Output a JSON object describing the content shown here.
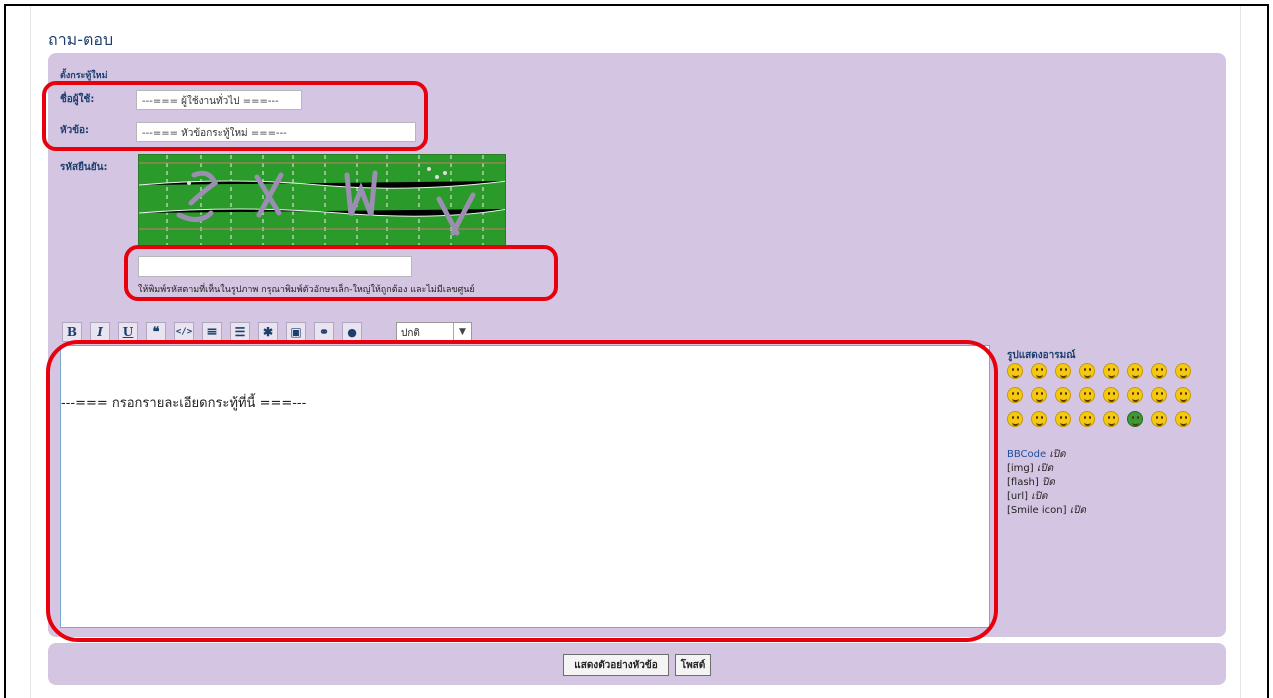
{
  "page": {
    "title": "ถาม-ตอบ"
  },
  "form": {
    "section_title": "ตั้งกระทู้ใหม่",
    "username_label": "ชื่อผู้ใช้:",
    "username_value": "---=== ผู้ใช้งานทั่วไป ===---",
    "subject_label": "หัวข้อ:",
    "subject_value": "---=== หัวข้อกระทู้ใหม่ ===---",
    "captcha_label": "รหัสยืนยัน:",
    "captcha_input_value": "",
    "captcha_hint": "ให้พิมพ์รหัสตามที่เห็นในรูปภาพ กรุณาพิมพ์ตัวอักษรเล็ก-ใหญ่ให้ถูกต้อง และไม่มีเลขศูนย์"
  },
  "toolbar": {
    "bold": "B",
    "italic": "I",
    "underline": "U",
    "quote": "❝",
    "code": "</>",
    "list": "≡",
    "ordered_list": "☰",
    "list_item": "✱",
    "image": "▣",
    "link": "⚭",
    "color": "●",
    "size_select": "ปกติ"
  },
  "editor": {
    "content": "---=== กรอกรายละเอียดกระทู้ที่นี้ ===---"
  },
  "emoticons": {
    "title": "รูปแสดงอารมณ์",
    "count": 24
  },
  "bbcode_status": {
    "bbcode_label": "BBCode",
    "bbcode_state": "เปิด",
    "img_label": "[img]",
    "img_state": "เปิด",
    "flash_label": "[flash]",
    "flash_state": "ปิด",
    "url_label": "[url]",
    "url_state": "เปิด",
    "smile_label": "[Smile icon]",
    "smile_state": "เปิด"
  },
  "buttons": {
    "preview": "แสดงตัวอย่างหัวข้อ",
    "post": "โพสต์"
  },
  "colors": {
    "panel": "#d4c5e2",
    "heading": "#1d3f6e",
    "highlight": "#e8000d",
    "captcha_bg": "#2a9a2a"
  }
}
